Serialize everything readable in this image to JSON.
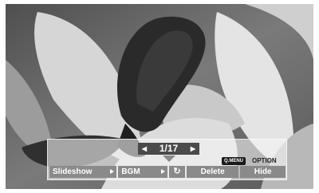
{
  "viewer": {
    "counter": "1/17",
    "menu": {
      "qmenu_label": "Q.MENU",
      "option_label": "OPTION"
    },
    "buttons": {
      "slideshow": "Slideshow",
      "bgm": "BGM",
      "delete": "Delete",
      "hide": "Hide"
    }
  },
  "icons": {
    "prev": "chevron-left-icon",
    "next": "chevron-right-icon",
    "submenu": "triangle-right-icon",
    "repeat": "rotate-icon"
  },
  "colors": {
    "button_bg": "#8a8a8a",
    "counter_bg": "#4a4a4a",
    "qmenu_bg": "#1a1a1a"
  }
}
